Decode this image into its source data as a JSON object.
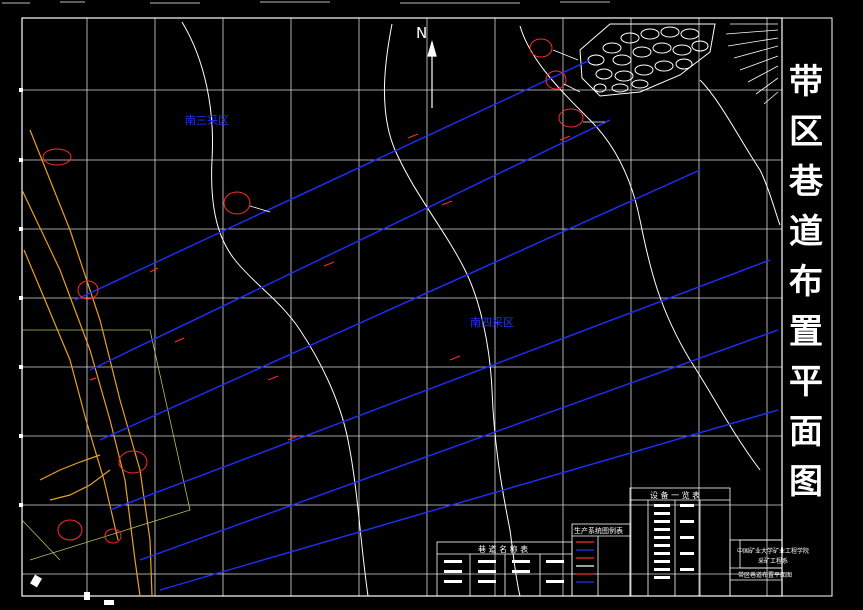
{
  "drawing": {
    "title_chars": [
      "带",
      "区",
      "巷",
      "道",
      "布",
      "置",
      "平",
      "面",
      "图"
    ],
    "north_label": "N",
    "label_left": "南三采区",
    "label_center": "南四采区",
    "table_main_header": "设 备 一 览 表",
    "table_left_header": "巷 道 名 称 表",
    "table_mid_header": "生产系统图例表",
    "titleblock_line1": "中国矿业大学矿业工程学院",
    "titleblock_line2": "采矿工程系",
    "titleblock_line3": "带区巷道布置平面图"
  },
  "colors": {
    "background": "#000000",
    "grid": "#ffffff",
    "roadway": "#1f2fff",
    "accent": "#ff2a2a",
    "fault": "#e8a020",
    "boundary": "#b8c060"
  }
}
